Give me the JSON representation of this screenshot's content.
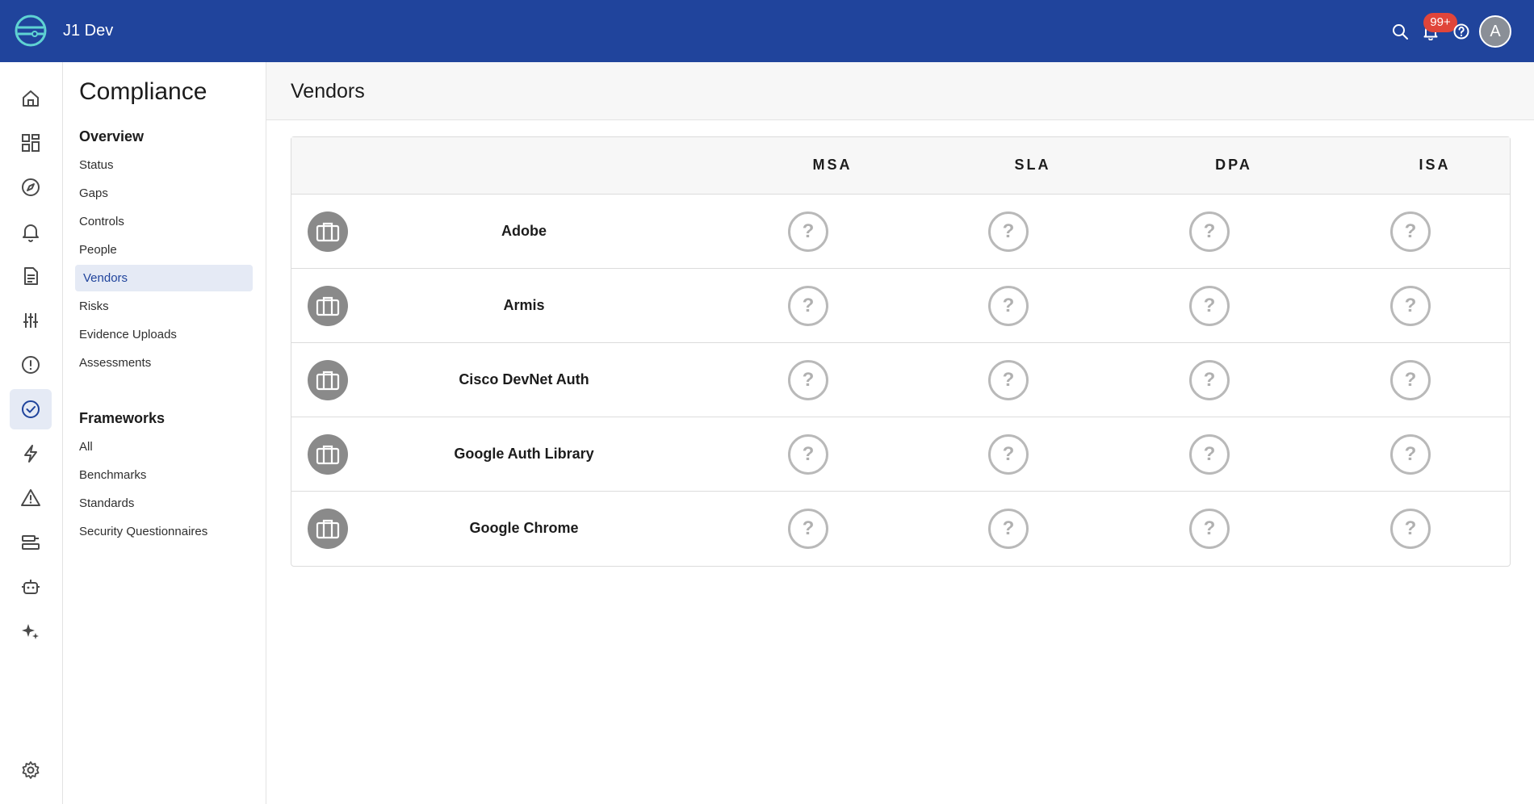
{
  "app": {
    "title": "J1 Dev",
    "notification_badge": "99+",
    "avatar_initial": "A",
    "colors": {
      "topbar": "#20449c",
      "accent": "#20449c",
      "active_bg": "#e5eaf5",
      "badge": "#e0453a"
    }
  },
  "rail": {
    "items": [
      {
        "icon": "home-icon"
      },
      {
        "icon": "dashboard-icon"
      },
      {
        "icon": "compass-icon"
      },
      {
        "icon": "bell-icon"
      },
      {
        "icon": "document-icon"
      },
      {
        "icon": "sliders-icon"
      },
      {
        "icon": "alert-circle-icon"
      },
      {
        "icon": "check-circle-icon",
        "active": true
      },
      {
        "icon": "lightning-icon"
      },
      {
        "icon": "warning-triangle-icon"
      },
      {
        "icon": "list-icon"
      },
      {
        "icon": "robot-icon"
      },
      {
        "icon": "sparkle-icon"
      }
    ],
    "settings_icon": "gear-icon"
  },
  "subnav": {
    "title": "Compliance",
    "overview": {
      "title": "Overview",
      "items": [
        "Status",
        "Gaps",
        "Controls",
        "People",
        "Vendors",
        "Risks",
        "Evidence Uploads",
        "Assessments"
      ],
      "active": "Vendors"
    },
    "frameworks": {
      "title": "Frameworks",
      "items": [
        "All",
        "Benchmarks",
        "Standards",
        "Security Questionnaires"
      ]
    }
  },
  "main": {
    "title": "Vendors",
    "table": {
      "columns": [
        "MSA",
        "SLA",
        "DPA",
        "ISA"
      ],
      "status_glyph": "?",
      "rows": [
        {
          "name": "Adobe",
          "statuses": [
            "unknown",
            "unknown",
            "unknown",
            "unknown"
          ]
        },
        {
          "name": "Armis",
          "statuses": [
            "unknown",
            "unknown",
            "unknown",
            "unknown"
          ]
        },
        {
          "name": "Cisco DevNet Auth",
          "statuses": [
            "unknown",
            "unknown",
            "unknown",
            "unknown"
          ]
        },
        {
          "name": "Google Auth Library",
          "statuses": [
            "unknown",
            "unknown",
            "unknown",
            "unknown"
          ]
        },
        {
          "name": "Google Chrome",
          "statuses": [
            "unknown",
            "unknown",
            "unknown",
            "unknown"
          ]
        }
      ]
    }
  }
}
